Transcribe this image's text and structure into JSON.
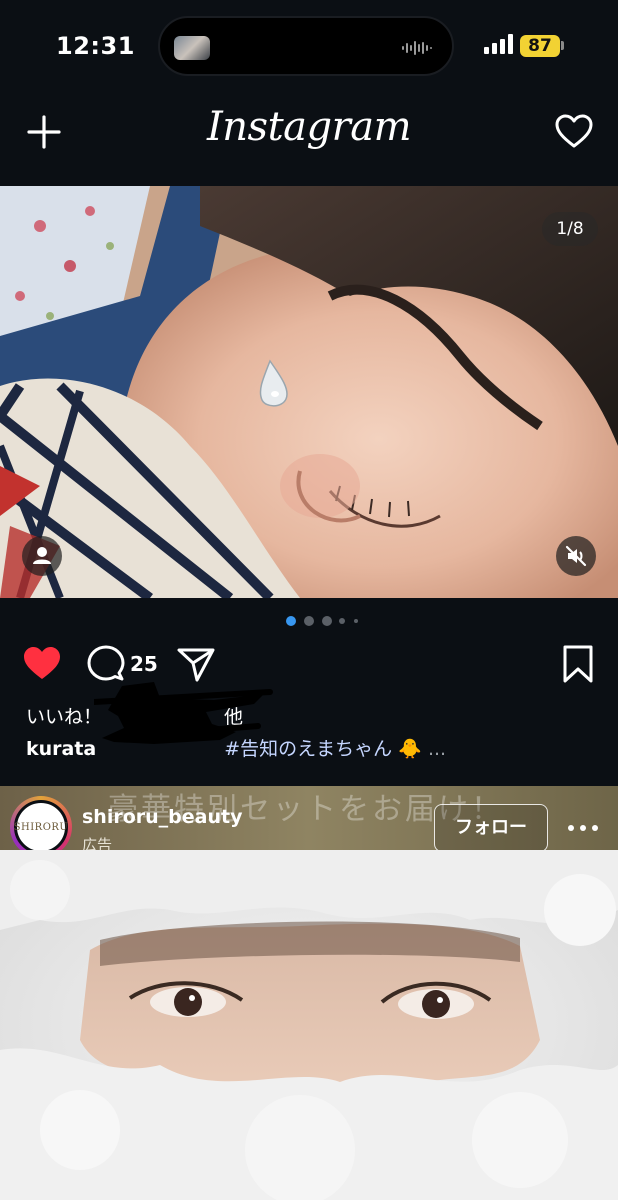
{
  "status_bar": {
    "time": "12:31",
    "battery": "87",
    "battery_color": "#f2d233"
  },
  "header": {
    "logo": "Instagram",
    "create_icon": "plus-icon",
    "activity_icon": "heart-outline-icon"
  },
  "post": {
    "media_counter": "1/8",
    "carousel_total_dots": 5,
    "carousel_active_index": 0,
    "liked": true,
    "like_color": "#ff3040",
    "comment_count": "25",
    "likes_prefix": "いいね！",
    "likes_suffix": "他",
    "caption_user": "kurata",
    "caption_hashtag": "#告知のえまちゃん",
    "caption_emoji": "🐥",
    "caption_more": "..."
  },
  "ad": {
    "watermark_text": "豪華特別セットをお届け！",
    "avatar_text": "SHIRORU",
    "account_name": "shiroru_beauty",
    "sponsored_label": "広告",
    "follow_label": "フォロー"
  }
}
